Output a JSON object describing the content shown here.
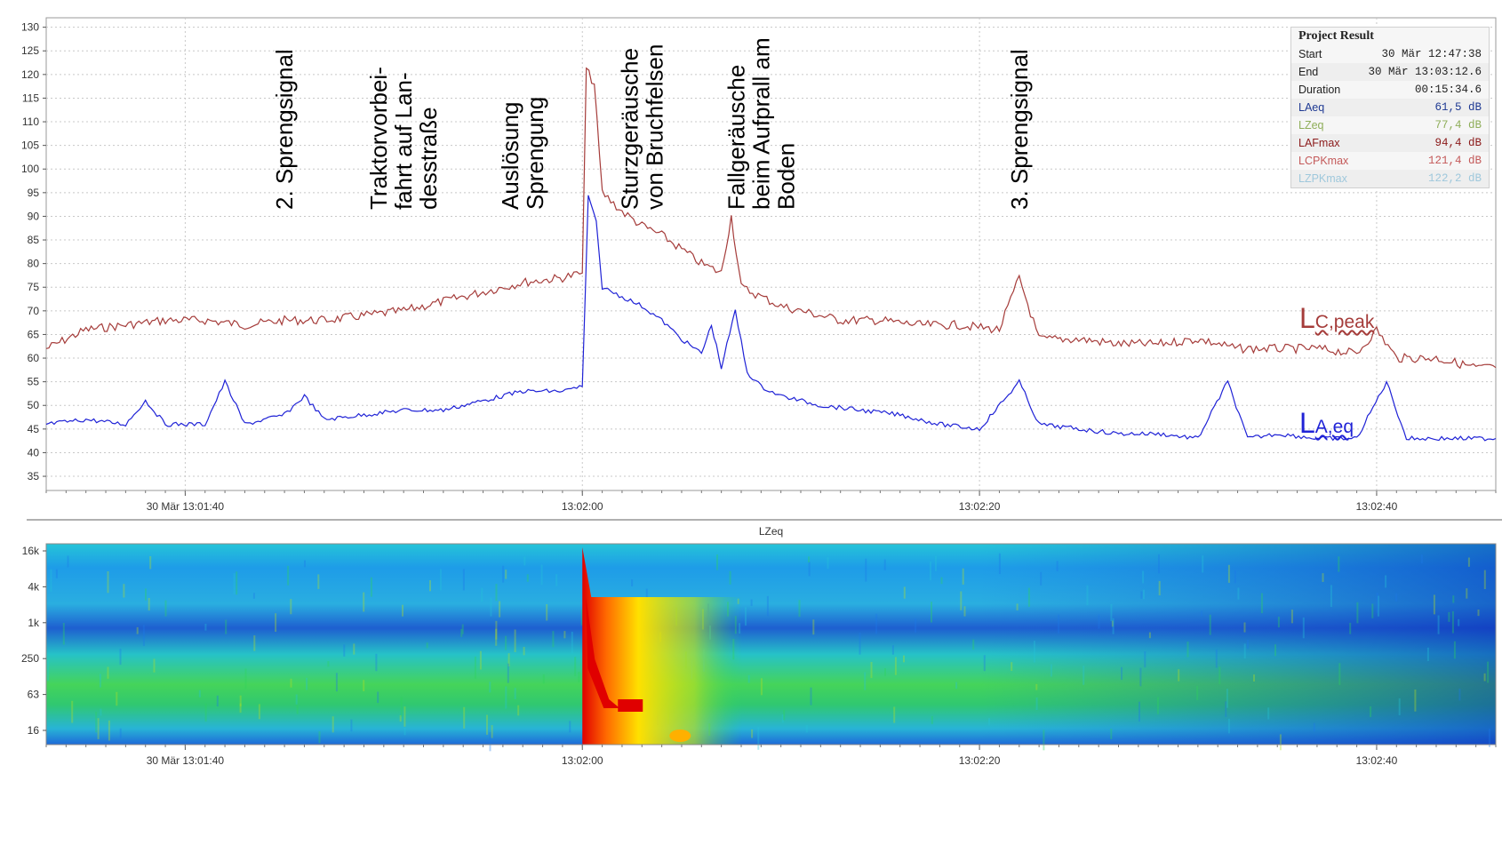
{
  "chart_data": [
    {
      "type": "line",
      "title": "",
      "xlabel": "",
      "ylabel": "",
      "ylim": [
        32,
        132
      ],
      "yticks": [
        35,
        40,
        45,
        50,
        55,
        60,
        65,
        70,
        75,
        80,
        85,
        90,
        95,
        100,
        105,
        110,
        115,
        120,
        125,
        130
      ],
      "xlim": [
        "13:01:33",
        "13:02:46"
      ],
      "xtick_labels": [
        "30 Mär 13:01:40",
        "13:02:00",
        "13:02:20",
        "13:02:40"
      ],
      "xtick_values": [
        "13:01:40",
        "13:02:00",
        "13:02:20",
        "13:02:40"
      ],
      "grid": true,
      "series": [
        {
          "name": "LC,peak",
          "color": "#a53c3a",
          "points": [
            [
              "13:01:33",
              62
            ],
            [
              "13:01:35",
              66
            ],
            [
              "13:01:37",
              67
            ],
            [
              "13:01:39",
              68
            ],
            [
              "13:01:41",
              68
            ],
            [
              "13:01:43",
              67
            ],
            [
              "13:01:45",
              68
            ],
            [
              "13:01:47",
              68
            ],
            [
              "13:01:49",
              69
            ],
            [
              "13:01:51",
              70
            ],
            [
              "13:01:53",
              72
            ],
            [
              "13:01:55",
              74
            ],
            [
              "13:01:57",
              76
            ],
            [
              "13:01:59",
              77
            ],
            [
              "13:02:00",
              78
            ],
            [
              "13:02:00.2",
              121
            ],
            [
              "13:02:00.6",
              118
            ],
            [
              "13:02:01",
              95
            ],
            [
              "13:02:02",
              91
            ],
            [
              "13:02:03",
              88
            ],
            [
              "13:02:04",
              86
            ],
            [
              "13:02:05",
              83
            ],
            [
              "13:02:06",
              80
            ],
            [
              "13:02:07",
              78
            ],
            [
              "13:02:07.5",
              90
            ],
            [
              "13:02:08",
              75
            ],
            [
              "13:02:09",
              73
            ],
            [
              "13:02:10",
              71
            ],
            [
              "13:02:11",
              70
            ],
            [
              "13:02:13",
              68
            ],
            [
              "13:02:15",
              68
            ],
            [
              "13:02:17",
              67
            ],
            [
              "13:02:19",
              67
            ],
            [
              "13:02:21",
              66
            ],
            [
              "13:02:22",
              77
            ],
            [
              "13:02:23",
              64
            ],
            [
              "13:02:25",
              64
            ],
            [
              "13:02:27",
              63
            ],
            [
              "13:02:29",
              63
            ],
            [
              "13:02:31",
              64
            ],
            [
              "13:02:33",
              62
            ],
            [
              "13:02:35",
              62
            ],
            [
              "13:02:37",
              62
            ],
            [
              "13:02:39",
              61
            ],
            [
              "13:02:40",
              66
            ],
            [
              "13:02:41",
              60
            ],
            [
              "13:02:43",
              60
            ],
            [
              "13:02:45",
              58
            ],
            [
              "13:02:46",
              58
            ]
          ]
        },
        {
          "name": "LA,eq",
          "color": "#1f22d6",
          "points": [
            [
              "13:01:33",
              46
            ],
            [
              "13:01:35",
              47
            ],
            [
              "13:01:37",
              46
            ],
            [
              "13:01:38",
              51
            ],
            [
              "13:01:39",
              46
            ],
            [
              "13:01:41",
              46
            ],
            [
              "13:01:42",
              55
            ],
            [
              "13:01:43",
              46
            ],
            [
              "13:01:45",
              48
            ],
            [
              "13:01:46",
              52
            ],
            [
              "13:01:47",
              47
            ],
            [
              "13:01:49",
              48
            ],
            [
              "13:01:51",
              49
            ],
            [
              "13:01:53",
              49
            ],
            [
              "13:01:55",
              51
            ],
            [
              "13:01:57",
              53
            ],
            [
              "13:01:59",
              53
            ],
            [
              "13:02:00",
              54
            ],
            [
              "13:02:00.3",
              94
            ],
            [
              "13:02:00.7",
              89
            ],
            [
              "13:02:01",
              75
            ],
            [
              "13:02:02",
              73
            ],
            [
              "13:02:03",
              71
            ],
            [
              "13:02:04",
              68
            ],
            [
              "13:02:05",
              64
            ],
            [
              "13:02:06",
              61
            ],
            [
              "13:02:06.5",
              67
            ],
            [
              "13:02:07",
              58
            ],
            [
              "13:02:07.7",
              70
            ],
            [
              "13:02:08.3",
              57
            ],
            [
              "13:02:09",
              54
            ],
            [
              "13:02:10",
              52
            ],
            [
              "13:02:12",
              50
            ],
            [
              "13:02:14",
              49
            ],
            [
              "13:02:16",
              48
            ],
            [
              "13:02:18",
              46
            ],
            [
              "13:02:20",
              45
            ],
            [
              "13:02:22",
              55
            ],
            [
              "13:02:23",
              46
            ],
            [
              "13:02:25",
              45
            ],
            [
              "13:02:27",
              44
            ],
            [
              "13:02:29",
              44
            ],
            [
              "13:02:31",
              43
            ],
            [
              "13:02:32.5",
              55
            ],
            [
              "13:02:33.5",
              43
            ],
            [
              "13:02:35",
              44
            ],
            [
              "13:02:37",
              43
            ],
            [
              "13:02:39",
              43
            ],
            [
              "13:02:40.5",
              55
            ],
            [
              "13:02:41.5",
              43
            ],
            [
              "13:02:43",
              43
            ],
            [
              "13:02:46",
              43
            ]
          ]
        }
      ],
      "annotations": [
        {
          "time": "13:01:45",
          "lines": [
            "2. Sprengsignal"
          ]
        },
        {
          "time": "13:01:51",
          "lines": [
            "Traktorvorbei-",
            "fahrt auf Lan-",
            "desstraße"
          ]
        },
        {
          "time": "13:01:57",
          "lines": [
            "Auslösung",
            "Sprengung"
          ]
        },
        {
          "time": "13:02:03",
          "lines": [
            "Sturzgeräusche",
            "von Bruchfelsen"
          ]
        },
        {
          "time": "13:02:09",
          "lines": [
            "Fallgeräusche",
            "beim Aufprall am",
            "Boden"
          ]
        },
        {
          "time": "13:02:22",
          "lines": [
            "3. Sprengsignal"
          ]
        }
      ],
      "series_labels": [
        {
          "series": "LC,peak",
          "main": "L",
          "sub": "C,peak"
        },
        {
          "series": "LA,eq",
          "main": "L",
          "sub": "A,eq"
        }
      ]
    },
    {
      "type": "heatmap",
      "title": "LZeq",
      "xlim": [
        "13:01:33",
        "13:02:46"
      ],
      "xtick_labels": [
        "30 Mär 13:01:40",
        "13:02:00",
        "13:02:20",
        "13:02:40"
      ],
      "xtick_values": [
        "13:01:40",
        "13:02:00",
        "13:02:20",
        "13:02:40"
      ],
      "yticks": [
        "16k",
        "4k",
        "1k",
        "250",
        "63",
        "16"
      ],
      "colormap": [
        "#0a1fb8",
        "#1e78e8",
        "#25c4d8",
        "#2fd45a",
        "#b8e020",
        "#ffe000",
        "#ff6a00",
        "#e00000"
      ]
    }
  ],
  "result_panel": {
    "title": "Project Result",
    "rows": [
      {
        "label": "Start",
        "value": "30 Mär 12:47:38",
        "color": "#222222"
      },
      {
        "label": "End",
        "value": "30 Mär 13:03:12.6",
        "color": "#222222"
      },
      {
        "label": "Duration",
        "value": "00:15:34.6",
        "color": "#222222"
      },
      {
        "label": "LAeq",
        "value": "61,5 dB",
        "color": "#1f3a93"
      },
      {
        "label": "LZeq",
        "value": "77,4 dB",
        "color": "#8fae5a"
      },
      {
        "label": "LAFmax",
        "value": "94,4 dB",
        "color": "#8b1a1a"
      },
      {
        "label": "LCPKmax",
        "value": "121,4 dB",
        "color": "#c45a5a"
      },
      {
        "label": "LZPKmax",
        "value": "122,2 dB",
        "color": "#9fc8dc"
      }
    ]
  }
}
